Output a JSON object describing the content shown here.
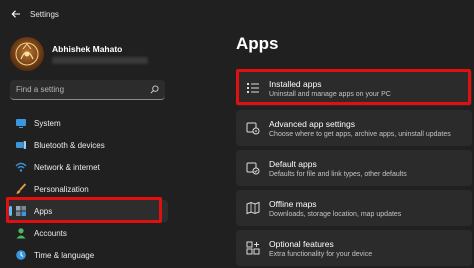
{
  "window": {
    "title": "Settings"
  },
  "profile": {
    "name": "Abhishek Mahato"
  },
  "search": {
    "placeholder": "Find a setting"
  },
  "sidebar": {
    "items": [
      {
        "label": "System",
        "icon": "monitor-icon"
      },
      {
        "label": "Bluetooth & devices",
        "icon": "bluetooth-devices-icon"
      },
      {
        "label": "Network & internet",
        "icon": "wifi-icon"
      },
      {
        "label": "Personalization",
        "icon": "brush-icon"
      },
      {
        "label": "Apps",
        "icon": "apps-icon",
        "selected": true
      },
      {
        "label": "Accounts",
        "icon": "person-icon"
      },
      {
        "label": "Time & language",
        "icon": "globe-clock-icon"
      }
    ]
  },
  "main": {
    "title": "Apps",
    "cards": [
      {
        "title": "Installed apps",
        "subtitle": "Uninstall and manage apps on your PC",
        "icon": "list-icon"
      },
      {
        "title": "Advanced app settings",
        "subtitle": "Choose where to get apps, archive apps, uninstall updates",
        "icon": "app-settings-icon"
      },
      {
        "title": "Default apps",
        "subtitle": "Defaults for file and link types, other defaults",
        "icon": "default-apps-icon"
      },
      {
        "title": "Offline maps",
        "subtitle": "Downloads, storage location, map updates",
        "icon": "map-icon"
      },
      {
        "title": "Optional features",
        "subtitle": "Extra functionality for your device",
        "icon": "optional-features-icon"
      }
    ]
  },
  "colors": {
    "background": "#202020",
    "card": "#2b2b2b",
    "accent": "#4cc2ff",
    "highlight_box": "#e01010"
  }
}
